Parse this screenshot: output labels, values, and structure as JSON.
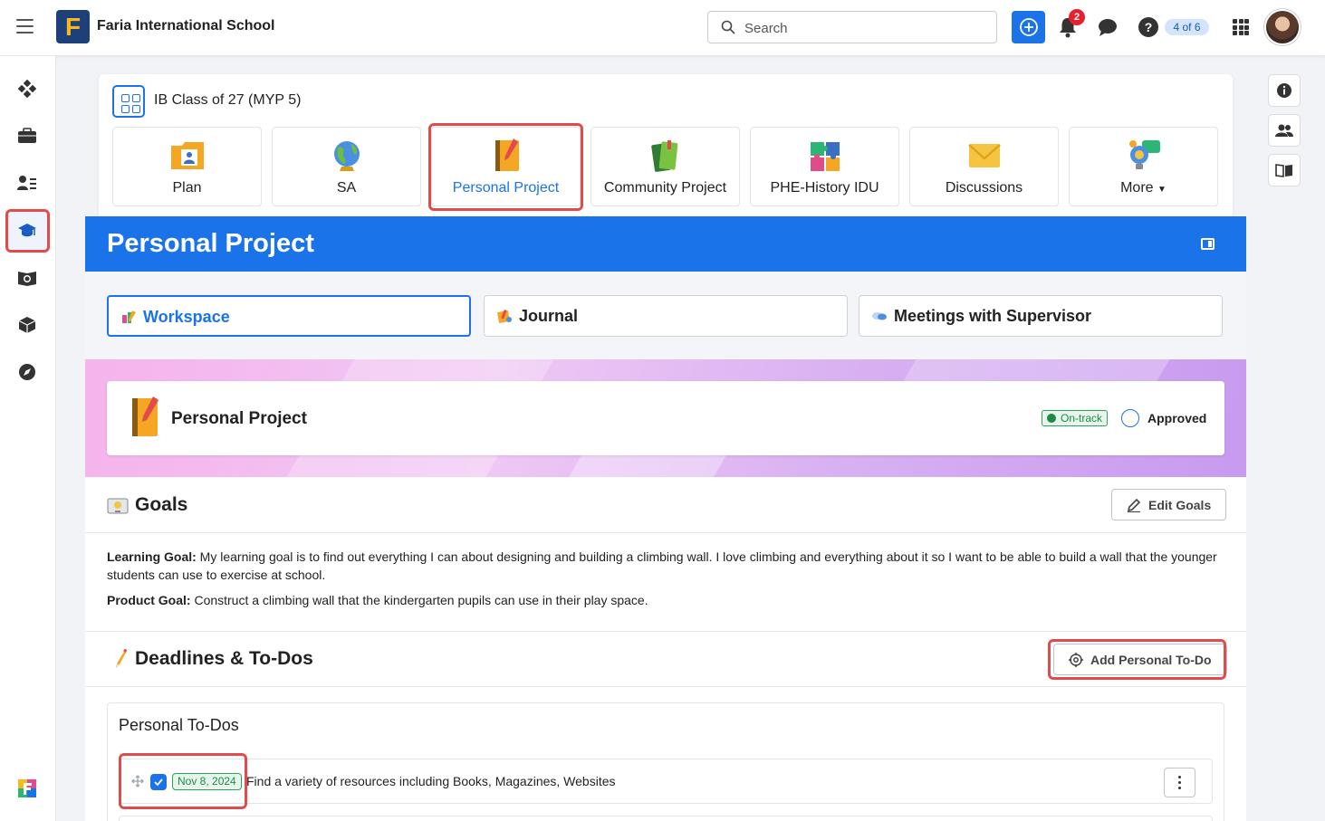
{
  "topbar": {
    "school_name": "Faria International School",
    "logo_letter": "F",
    "search_placeholder": "Search",
    "notification_count": "2",
    "help_symbol": "?",
    "page_counter": "4 of 6"
  },
  "sidebar": {
    "items": [
      "dashboard-icon",
      "briefcase-icon",
      "people-list-icon",
      "graduation-cap-icon",
      "book-globe-icon",
      "cube-icon",
      "compass-icon",
      "faria-logo-icon"
    ]
  },
  "class": {
    "title": "IB Class of 27 (MYP 5)",
    "tiles": [
      {
        "label": "Plan",
        "icon": "plan-folder-icon"
      },
      {
        "label": "SA",
        "icon": "globe-icon"
      },
      {
        "label": "Personal Project",
        "icon": "notebook-icon"
      },
      {
        "label": "Community Project",
        "icon": "books-icon"
      },
      {
        "label": "PHE-History IDU",
        "icon": "puzzle-icon"
      },
      {
        "label": "Discussions",
        "icon": "envelope-icon"
      },
      {
        "label": "More",
        "icon": "bulb-chat-icon"
      }
    ]
  },
  "page": {
    "title": "Personal Project",
    "tabs": [
      {
        "label": "Workspace"
      },
      {
        "label": "Journal"
      },
      {
        "label": "Meetings with Supervisor"
      }
    ],
    "project_card": {
      "title": "Personal Project",
      "status": "On-track",
      "approval": "Approved"
    },
    "goals": {
      "heading": "Goals",
      "edit_label": "Edit Goals",
      "learning_label": "Learning Goal:",
      "learning_text": " My learning goal is to find out everything I can about designing and building a climbing wall. I love climbing and everything about it so I want to be able to build a wall that the younger students can use to exercise at school.",
      "product_label": "Product Goal:",
      "product_text": " Construct a climbing wall that the kindergarten pupils can use in their play space."
    },
    "deadlines": {
      "heading": "Deadlines & To-Dos",
      "add_label": "Add Personal To-Do",
      "box_heading": "Personal To-Dos",
      "items": [
        {
          "date": "Nov 8, 2024",
          "text": "Find a variety of resources including Books, Magazines, Websites",
          "checked": true
        }
      ]
    }
  },
  "colors": {
    "accent": "#1a73e8",
    "highlight": "#e24b4b",
    "success": "#1e8b45"
  }
}
